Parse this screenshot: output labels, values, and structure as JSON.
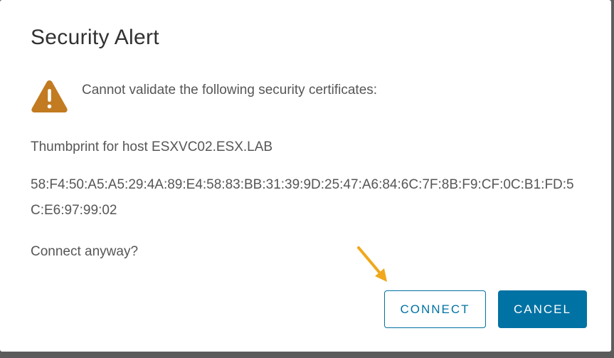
{
  "dialog": {
    "title": "Security Alert",
    "alert_message": "Cannot validate the following security certificates:",
    "alert_icon": "warning-triangle-icon",
    "host_line": "Thumbprint for host ESXVC02.ESX.LAB",
    "thumbprint": "58:F4:50:A5:A5:29:4A:89:E4:58:83:BB:31:39:9D:25:47:A6:84:6C:7F:8B:F9:CF:0C:B1:FD:5C:E6:97:99:02",
    "question": "Connect anyway?",
    "buttons": {
      "connect_label": "CONNECT",
      "cancel_label": "CANCEL"
    }
  },
  "annotation": {
    "arrow_icon": "pointer-arrow-icon",
    "arrow_color": "#f0a81c"
  },
  "colors": {
    "accent": "#0072a3",
    "warning": "#c27b20",
    "text": "#565656",
    "backdrop": "#5f5f5f"
  }
}
